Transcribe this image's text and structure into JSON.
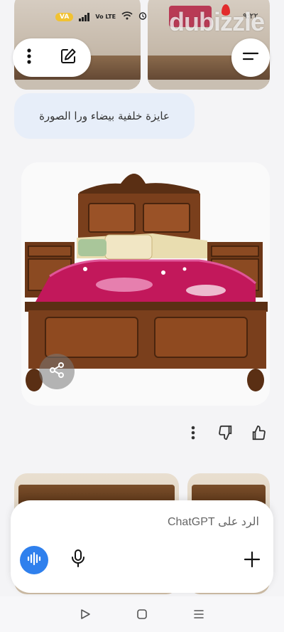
{
  "status_bar": {
    "carrier_badge": "VA",
    "network_label": "Vo LTE",
    "time": "٩:٢٢"
  },
  "watermark": {
    "text": "dubizzle"
  },
  "message": {
    "text": "عايزة خلفية بيضاء ورا الصورة"
  },
  "composer": {
    "placeholder": "الرد على ChatGPT"
  },
  "colors": {
    "accent": "#2f80ed",
    "bubble": "#e7eef9",
    "bed_wood": "#6b3a1f",
    "blanket": "#c2185b"
  },
  "icons": {
    "menu": "more-vertical-icon",
    "edit": "edit-icon",
    "sidebar": "menu-lines-icon",
    "share": "share-icon",
    "more": "more-vertical-icon",
    "dislike": "thumbs-down-icon",
    "like": "thumbs-up-icon",
    "voice": "voice-wave-icon",
    "mic": "mic-icon",
    "plus": "plus-icon",
    "nav_back": "play-triangle-icon",
    "nav_home": "square-icon",
    "nav_recent": "lines-icon"
  }
}
